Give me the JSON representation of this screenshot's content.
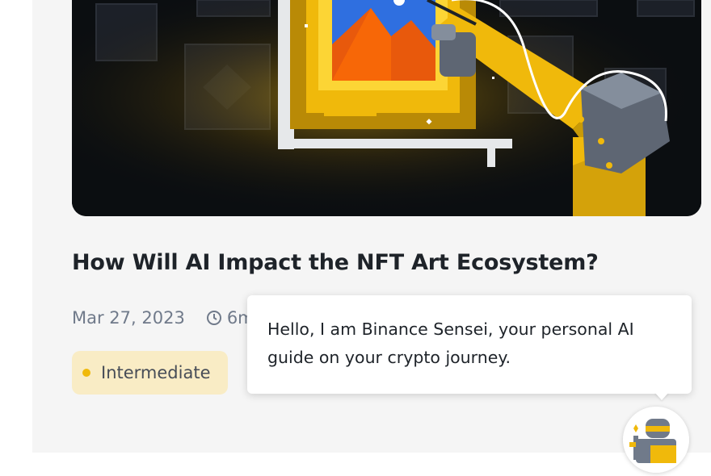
{
  "article": {
    "title": "How Will AI Impact the NFT Art Ecosystem?",
    "date": "Mar 27, 2023",
    "read_time": "6m",
    "level": "Intermediate"
  },
  "hero_image": {
    "icon": "robot-arm-painting-illustration"
  },
  "sensei": {
    "message": "Hello, I am Binance Sensei, your personal AI guide on your crypto journey.",
    "icon": "sensei-avatar-icon"
  },
  "colors": {
    "brand_yellow": "#F0B90B",
    "badge_bg": "#F9ECC5",
    "text_primary": "#1E2329",
    "text_secondary": "#707A8A"
  }
}
